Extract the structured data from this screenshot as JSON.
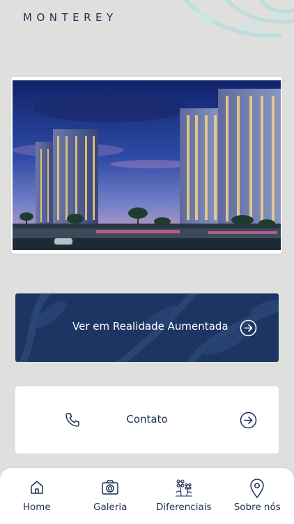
{
  "brand": {
    "logo_text": "MONTEREY"
  },
  "hero": {
    "image_alt": "building-render"
  },
  "ar_button": {
    "label": "Ver em Realidade Aumentada",
    "icon": "arrow-right-circle-icon"
  },
  "contact_button": {
    "label": "Contato",
    "icon": "phone-icon",
    "arrow_icon": "arrow-right-circle-icon"
  },
  "tabbar": {
    "items": [
      {
        "label": "Home",
        "icon": "home-icon"
      },
      {
        "label": "Galeria",
        "icon": "camera-icon"
      },
      {
        "label": "Diferenciais",
        "icon": "flowers-icon"
      },
      {
        "label": "Sobre nós",
        "icon": "location-pin-icon"
      }
    ]
  },
  "colors": {
    "navy": "#1d3562",
    "background": "#dfe0de",
    "accent_teal": "#a9d3d6"
  }
}
